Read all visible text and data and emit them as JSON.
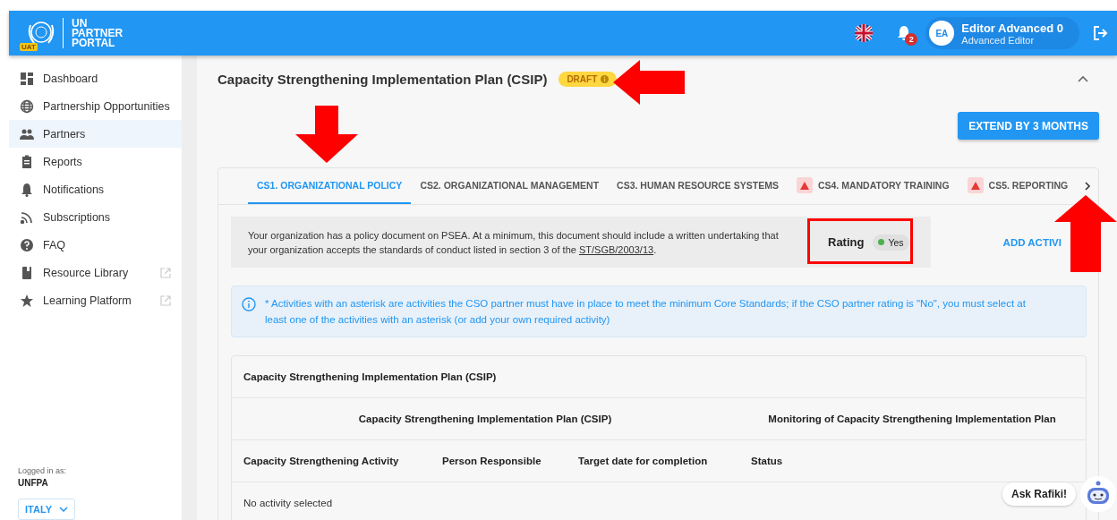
{
  "header": {
    "logo_badge": "UAT",
    "logo_lines": [
      "UN",
      "PARTNER",
      "PORTAL"
    ],
    "notification_count": "2",
    "user": {
      "initials": "EA",
      "name": "Editor Advanced 0",
      "role": "Advanced Editor"
    }
  },
  "sidebar": {
    "items": [
      {
        "label": "Dashboard",
        "kind": "dashboard",
        "selected": false,
        "external": false
      },
      {
        "label": "Partnership Opportunities",
        "kind": "globe",
        "selected": false,
        "external": false
      },
      {
        "label": "Partners",
        "kind": "people",
        "selected": true,
        "external": false
      },
      {
        "label": "Reports",
        "kind": "clipboard",
        "selected": false,
        "external": false
      },
      {
        "label": "Notifications",
        "kind": "bell",
        "selected": false,
        "external": false
      },
      {
        "label": "Subscriptions",
        "kind": "feed",
        "selected": false,
        "external": false
      },
      {
        "label": "FAQ",
        "kind": "help",
        "selected": false,
        "external": false
      },
      {
        "label": "Resource Library",
        "kind": "book",
        "selected": false,
        "external": true
      },
      {
        "label": "Learning Platform",
        "kind": "star",
        "selected": false,
        "external": true
      }
    ],
    "logged_in_label": "Logged in as:",
    "organization": "UNFPA",
    "country": "ITALY"
  },
  "section": {
    "title": "Capacity Strengthening Implementation Plan (CSIP)",
    "status": "DRAFT",
    "expanded": true,
    "extend_button": "EXTEND BY 3 MONTHS"
  },
  "tabs": [
    {
      "label": "CS1. ORGANIZATIONAL POLICY",
      "selected": true,
      "warning": false
    },
    {
      "label": "CS2. ORGANIZATIONAL MANAGEMENT",
      "selected": false,
      "warning": false
    },
    {
      "label": "CS3. HUMAN RESOURCE SYSTEMS",
      "selected": false,
      "warning": false
    },
    {
      "label": "CS4. MANDATORY TRAINING",
      "selected": false,
      "warning": true
    },
    {
      "label": "CS5. REPORTING",
      "selected": false,
      "warning": true
    }
  ],
  "standard": {
    "description": "Your organization has a policy document on PSEA. At a minimum, this document should include a written undertaking that your organization accepts the standards of conduct listed in section 3 of the ",
    "link": "ST/SGB/2003/13",
    "description_end": ".",
    "rating": {
      "label": "Rating",
      "value": "Yes",
      "color": "#4caf50"
    },
    "add_button": "ADD ACTIVI"
  },
  "info": "* Activities with an asterisk are activities the CSO partner must have in place to meet the minimum Core Standards; if the CSO partner rating is \"No\", you must select at least one of the activities with an asterisk (or add your own required activity)",
  "table": {
    "title": "Capacity Strengthening Implementation Plan (CSIP)",
    "groups": [
      "Capacity Strengthening Implementation Plan (CSIP)",
      "Monitoring of Capacity Strengthening Implementation Plan"
    ],
    "columns": [
      "Capacity Strengthening Activity",
      "Person Responsible",
      "Target date for completion",
      "Status"
    ],
    "empty": "No activity selected"
  },
  "assistant": "Ask Rafiki!"
}
